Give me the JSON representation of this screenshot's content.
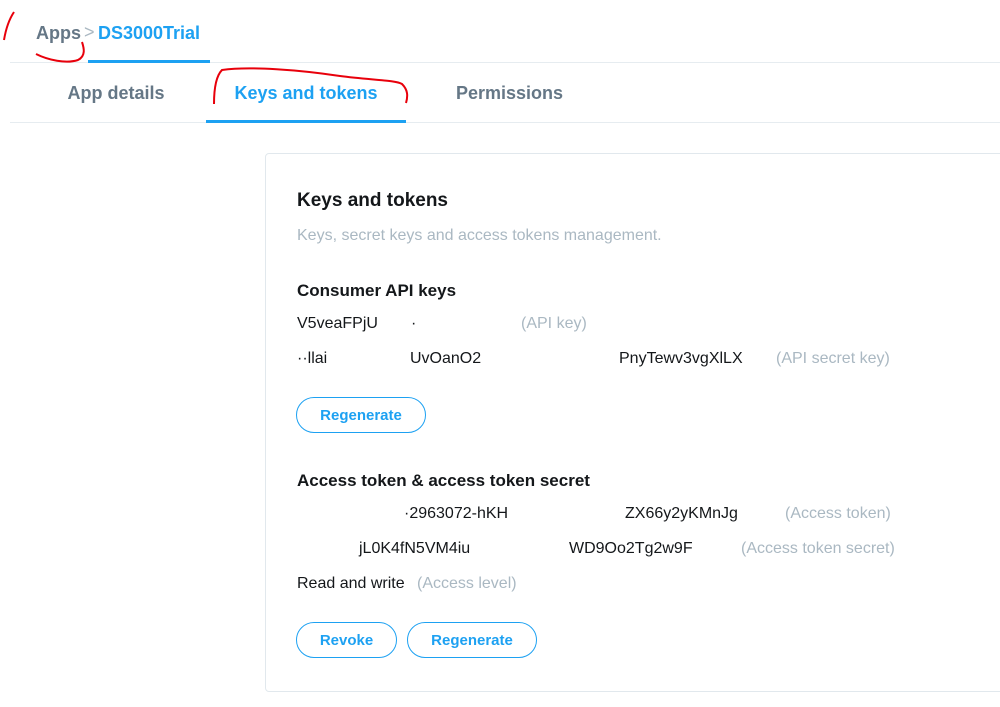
{
  "breadcrumb": {
    "root_label": "Apps",
    "separator": ">",
    "current_label": "DS3000Trial"
  },
  "tabs": [
    {
      "label": "App details",
      "active": false
    },
    {
      "label": "Keys and tokens",
      "active": true
    },
    {
      "label": "Permissions",
      "active": false
    }
  ],
  "card": {
    "title": "Keys and tokens",
    "subtitle": "Keys, secret keys and access tokens management.",
    "consumer": {
      "title": "Consumer API keys",
      "api_key": {
        "value_fragments": [
          "V5veaFPjU",
          "·"
        ],
        "hint": "(API key)"
      },
      "api_secret": {
        "value_fragments": [
          "··llai",
          "UvOanO2",
          "PnyTewv3vgXlLX"
        ],
        "hint": "(API secret key)"
      },
      "regenerate_label": "Regenerate"
    },
    "access": {
      "title": "Access token & access token secret",
      "token": {
        "value_fragments": [
          "·2963072-hKH",
          "ZX66y2yKMnJg"
        ],
        "hint": "(Access token)"
      },
      "token_secret": {
        "value_fragments": [
          "jL0K4fN5VM4iu",
          "WD9Oo2Tg2w9F"
        ],
        "hint": "(Access token secret)"
      },
      "level_value": "Read and write",
      "level_hint": "(Access level)",
      "revoke_label": "Revoke",
      "regenerate_label": "Regenerate"
    }
  },
  "colors": {
    "accent": "#1da1f2",
    "muted_text": "#657786",
    "hint_text": "#aab8c2",
    "annotation": "#e8000b"
  }
}
